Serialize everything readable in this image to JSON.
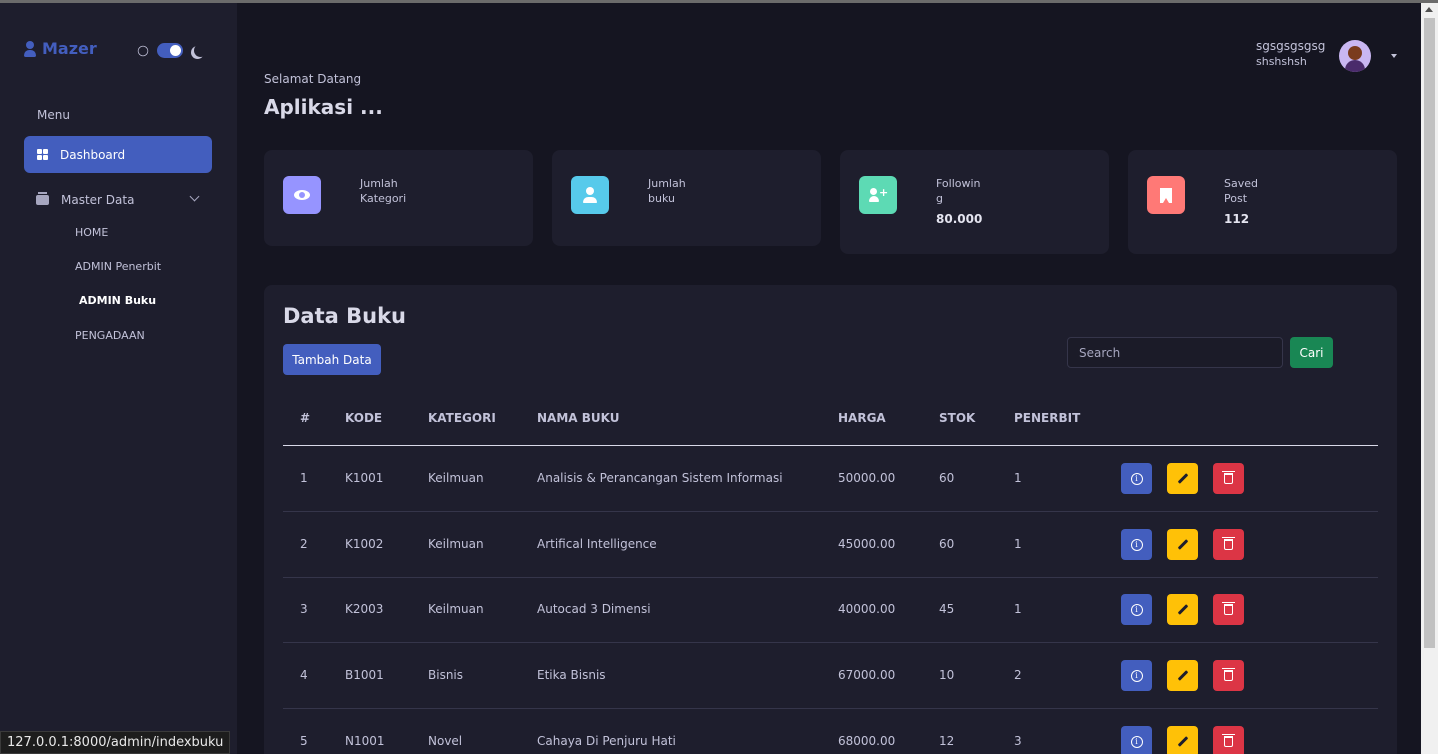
{
  "app": {
    "logo_text": "Mazer"
  },
  "sidebar": {
    "menu_title": "Menu",
    "dashboard_label": "Dashboard",
    "master_data_label": "Master Data",
    "submenu": [
      "HOME",
      "ADMIN Penerbit",
      "ADMIN Buku",
      "PENGADAAN"
    ],
    "active_submenu": "ADMIN Buku"
  },
  "header": {
    "username": "sgsgsgsgsg",
    "subtitle": "shshshsh"
  },
  "page": {
    "welcome": "Selamat Datang",
    "title": "Aplikasi ..."
  },
  "stats": [
    {
      "label": "Jumlah Kategori",
      "value": "",
      "icon": "eye-icon",
      "color": "#9694ff"
    },
    {
      "label": "Jumlah buku",
      "value": "",
      "icon": "user-icon",
      "color": "#57caeb"
    },
    {
      "label": "Following",
      "value": "80.000",
      "icon": "user-plus-icon",
      "color": "#5ddab4"
    },
    {
      "label": "Saved Post",
      "value": "112",
      "icon": "bookmark-icon",
      "color": "#ff7976"
    }
  ],
  "data_buku": {
    "title": "Data Buku",
    "add_button": "Tambah Data",
    "search_placeholder": "Search",
    "search_button": "Cari",
    "columns": [
      "#",
      "KODE",
      "KATEGORI",
      "NAMA BUKU",
      "HARGA",
      "STOK",
      "PENERBIT"
    ],
    "rows": [
      {
        "no": "1",
        "kode": "K1001",
        "kategori": "Keilmuan",
        "nama": "Analisis & Perancangan Sistem Informasi",
        "harga": "50000.00",
        "stok": "60",
        "penerbit": "1"
      },
      {
        "no": "2",
        "kode": "K1002",
        "kategori": "Keilmuan",
        "nama": "Artifical Intelligence",
        "harga": "45000.00",
        "stok": "60",
        "penerbit": "1"
      },
      {
        "no": "3",
        "kode": "K2003",
        "kategori": "Keilmuan",
        "nama": "Autocad 3 Dimensi",
        "harga": "40000.00",
        "stok": "45",
        "penerbit": "1"
      },
      {
        "no": "4",
        "kode": "B1001",
        "kategori": "Bisnis",
        "nama": "Etika Bisnis",
        "harga": "67000.00",
        "stok": "10",
        "penerbit": "2"
      },
      {
        "no": "5",
        "kode": "N1001",
        "kategori": "Novel",
        "nama": "Cahaya Di Penjuru Hati",
        "harga": "68000.00",
        "stok": "12",
        "penerbit": "3"
      }
    ]
  },
  "status_bar": {
    "url": "127.0.0.1:8000/admin/indexbuku"
  }
}
